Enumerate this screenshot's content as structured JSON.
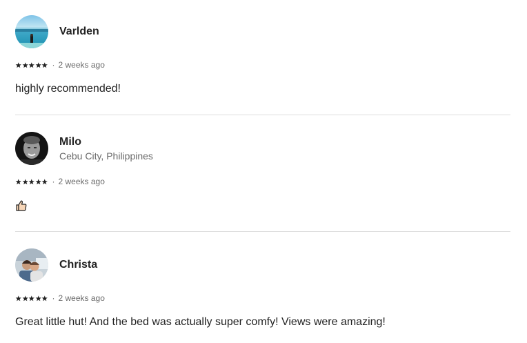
{
  "reviews": [
    {
      "name": "Varlden",
      "location": "",
      "rating": 5,
      "date": "2 weeks ago",
      "separator": "·",
      "text": "highly recommended!"
    },
    {
      "name": "Milo",
      "location": "Cebu City, Philippines",
      "rating": 5,
      "date": "2 weeks ago",
      "separator": "·",
      "text": "👍"
    },
    {
      "name": "Christa",
      "location": "",
      "rating": 5,
      "date": "2 weeks ago",
      "separator": "·",
      "text": "Great little hut! And the bed was actually super comfy! Views were amazing!"
    }
  ],
  "colors": {
    "text": "#222222",
    "secondary": "#6a6a6a",
    "divider": "#dddddd"
  },
  "icons": {
    "star": "star-icon",
    "thumbs_up": "thumbs-up-icon"
  }
}
